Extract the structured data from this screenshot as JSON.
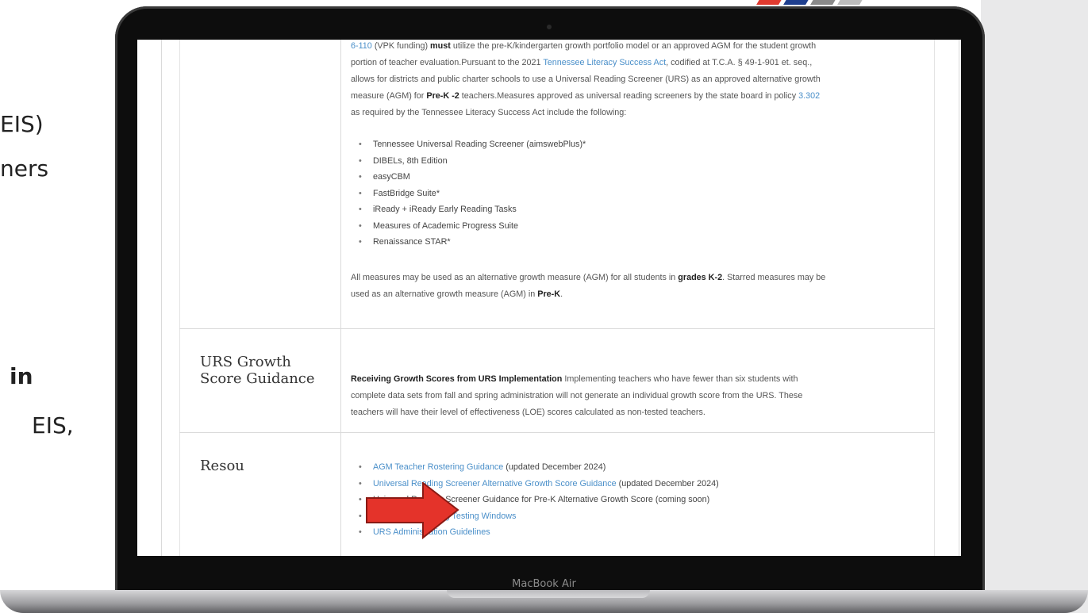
{
  "slide": {
    "left_text_fragments": [
      {
        "text": "EIS)",
        "bold": false
      },
      {
        "text": "ners",
        "bold": false
      },
      {
        "text": "in",
        "bold": true
      },
      {
        "text": "EIS,",
        "bold": false
      }
    ],
    "brand_colors": [
      "#e03a2f",
      "#1f3f8f",
      "#8a8a8a"
    ]
  },
  "laptop": {
    "label": "MacBook Air"
  },
  "page": {
    "intro_paragraph": {
      "line1_link": "6-110",
      "line1_pre": " (VPK funding) ",
      "line1_bold": "must",
      "line1_post": " utilize the pre-K/kindergarten growth portfolio model or an approved AGM for the student growth",
      "line2_pre": "portion of teacher evaluation.Pursuant to the 2021 ",
      "line2_link": "Tennessee Literacy Success Act",
      "line2_post": ", codified at T.C.A. § 49-1-901 et. seq.,",
      "line3": "allows for districts and public charter schools to use a Universal Reading Screener (URS) as an approved alternative growth",
      "line4_pre": "measure (AGM) for ",
      "line4_bold": "Pre-K -2",
      "line4_mid": " teachers.Measures approved as universal reading screeners by the state board in policy ",
      "line4_link": "3.302",
      "line5": "as required by the Tennessee Literacy Success Act include the following:"
    },
    "screeners": [
      "Tennessee Universal Reading Screener (aimswebPlus)*",
      "DIBELs, 8th Edition",
      "easyCBM",
      "FastBridge Suite*",
      "iReady + iReady Early Reading Tasks",
      "Measures of Academic Progress Suite",
      "Renaissance STAR*"
    ],
    "measures_note": {
      "pre": "All measures may be used as an alternative growth measure (AGM) for all students in ",
      "bold1": "grades K-2",
      "mid": ". Starred measures may be",
      "line2_pre": "used as an alternative growth measure (AGM) in ",
      "bold2": "Pre-K",
      "line2_post": "."
    },
    "urs_section": {
      "heading_line1": "URS Growth",
      "heading_line2": "Score Guidance",
      "bold_lead": "Receiving Growth Scores from URS Implementation",
      "line1_post": " Implementing teachers who have fewer than six students with",
      "line2": "complete data sets from fall and spring administration will not generate an individual growth score from the URS. These",
      "line3": "teachers will have their level of effectiveness (LOE) scores calculated as non-tested teachers."
    },
    "resources_section": {
      "heading": "Resou",
      "items": [
        {
          "link": "AGM Teacher Rostering Guidance",
          "note": " (updated December 2024)",
          "is_link": true
        },
        {
          "link": "Universal Reading Screener Alternative Growth Score Guidance",
          "note": " (updated December 2024)",
          "is_link": true
        },
        {
          "link": "Universal Reading Screener Guidance for Pre-K Alternative Growth Score (coming soon)",
          "note": "",
          "is_link": false
        },
        {
          "link": "Universal Screening Testing Windows",
          "note": "",
          "is_link": true
        },
        {
          "link": "URS Administration Guidelines",
          "note": "",
          "is_link": true
        }
      ]
    }
  }
}
